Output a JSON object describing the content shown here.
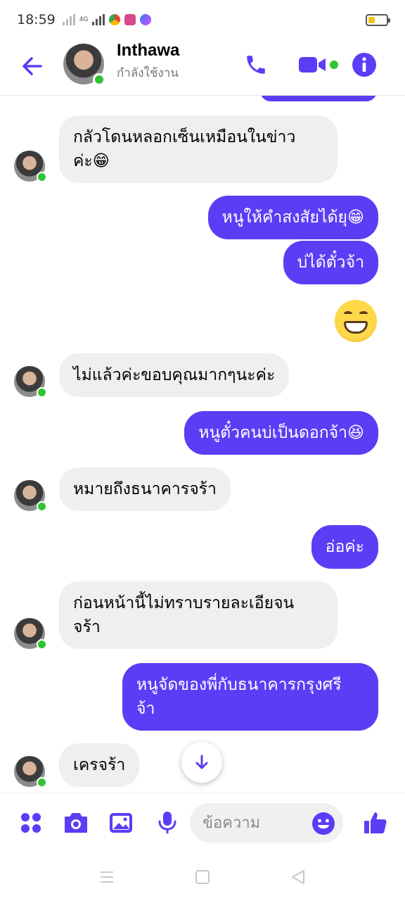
{
  "status_bar": {
    "time": "18:59",
    "network": "4G"
  },
  "header": {
    "name": "Inthawa",
    "status": "กำลังใช้งาน"
  },
  "messages": [
    {
      "from": "them",
      "text": "กลัวโดนหลอกเซ็นเหมือนในข่าว\nค่ะ😁"
    },
    {
      "from": "me",
      "text": "หนูให้คำสงสัยได้ยุ😁"
    },
    {
      "from": "me",
      "text": "บ่ได้ตั๋วจ้า"
    },
    {
      "from": "me",
      "emoji": "grinning-face-emoji"
    },
    {
      "from": "them",
      "text": "ไม่แล้วค่ะขอบคุณมากๆนะค่ะ"
    },
    {
      "from": "me",
      "text": "หนูตั๋วคนบ่เป็นดอกจ้า😆"
    },
    {
      "from": "them",
      "text": "หมายถึงธนาคารจร้า"
    },
    {
      "from": "me",
      "text": "อ่อค่ะ"
    },
    {
      "from": "them",
      "text": "ก่อนหน้านี้ไม่ทราบรายละเอียจน\nจร้า"
    },
    {
      "from": "me",
      "text": "หนูจัดของพี่กับธนาคารกรุงศรี\nจ้า"
    },
    {
      "from": "them",
      "text": "เครจร้า"
    }
  ],
  "composer": {
    "placeholder": "ข้อความ"
  },
  "colors": {
    "accent": "#5b3df5",
    "incoming_bubble": "#efefef",
    "online": "#31c332"
  },
  "icons": {
    "back": "arrow-left-icon",
    "call": "phone-icon",
    "video": "video-camera-icon",
    "info": "info-icon",
    "apps": "four-dots-icon",
    "camera": "camera-icon",
    "gallery": "image-icon",
    "mic": "microphone-icon",
    "emoji": "smiley-icon",
    "like": "thumbs-up-icon",
    "scroll": "arrow-down-icon"
  }
}
